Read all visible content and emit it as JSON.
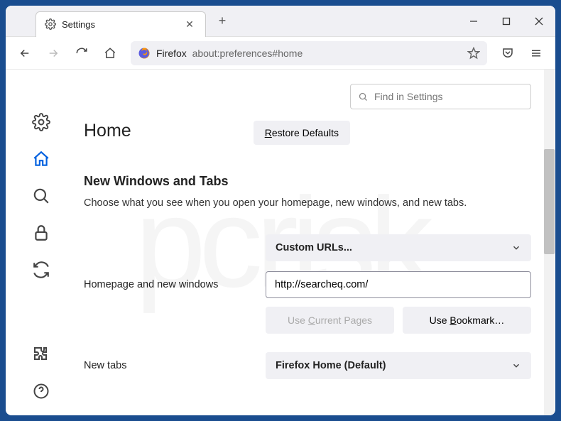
{
  "tab": {
    "title": "Settings"
  },
  "url": {
    "prefix": "Firefox",
    "address": "about:preferences#home"
  },
  "search": {
    "placeholder": "Find in Settings"
  },
  "page": {
    "title": "Home"
  },
  "buttons": {
    "restore": "Restore Defaults",
    "restore_ul": "R",
    "restore_rest": "estore Defaults",
    "use_current": "Use Current Pages",
    "use_current_pre": "Use ",
    "use_current_ul": "C",
    "use_current_post": "urrent Pages",
    "use_bookmark": "Use Bookmark…",
    "use_bookmark_pre": "Use ",
    "use_bookmark_ul": "B",
    "use_bookmark_post": "ookmark…"
  },
  "section": {
    "title": "New Windows and Tabs",
    "desc": "Choose what you see when you open your homepage, new windows, and new tabs."
  },
  "rows": {
    "homepage_label": "Homepage and new windows",
    "homepage_select": "Custom URLs...",
    "homepage_url": "http://searcheq.com/",
    "newtabs_label": "New tabs",
    "newtabs_select": "Firefox Home (Default)"
  }
}
